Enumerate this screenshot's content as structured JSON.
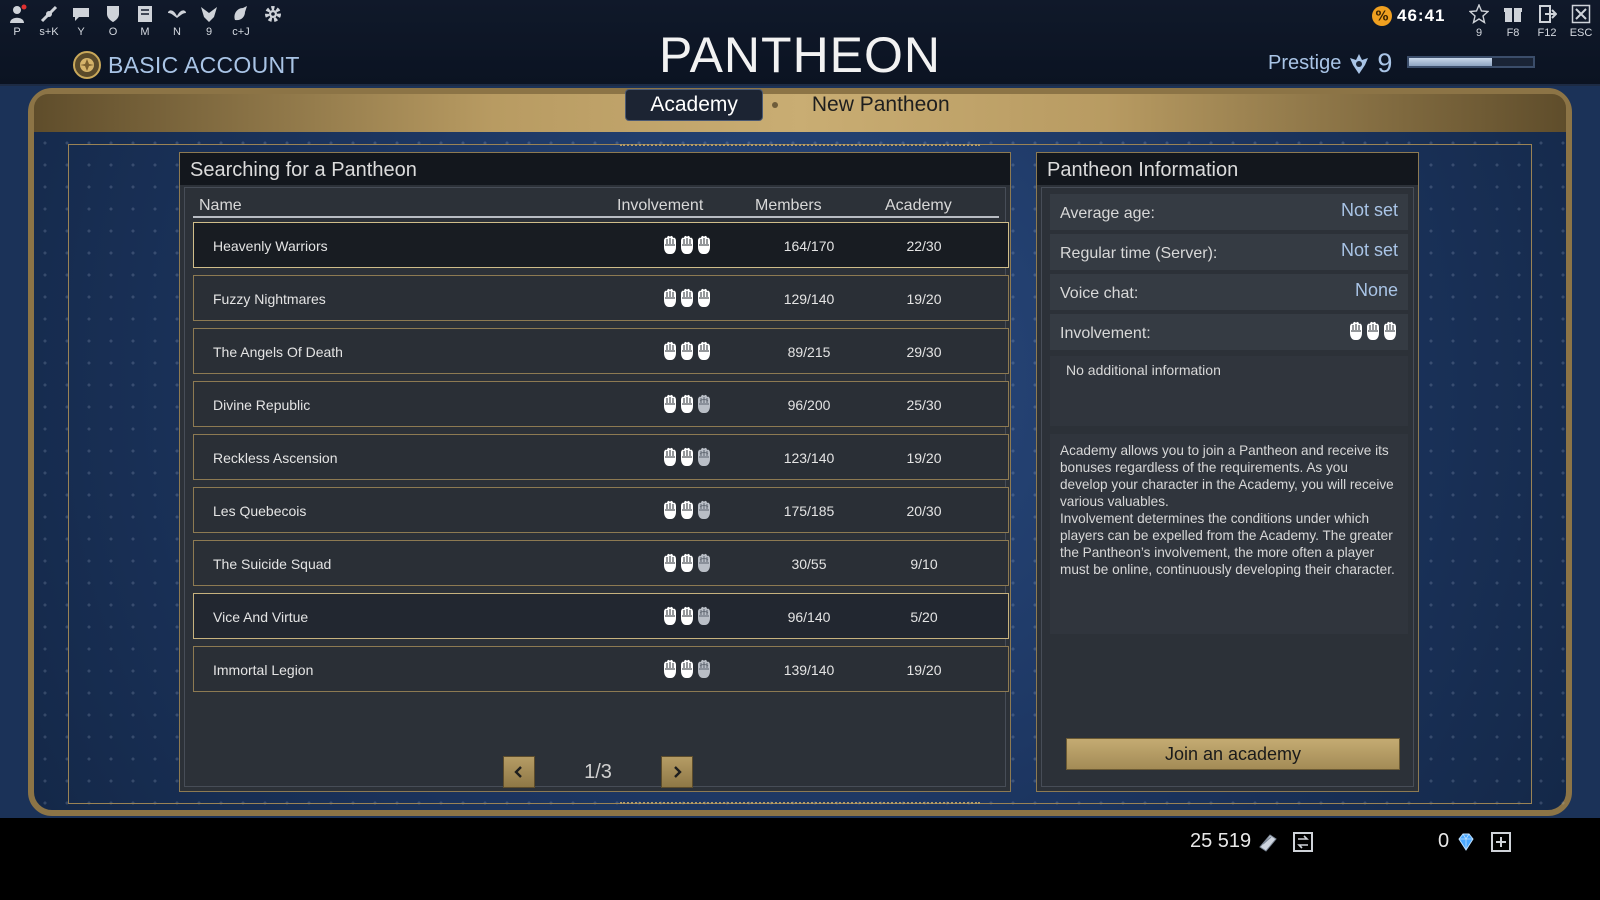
{
  "hotkeys": [
    {
      "label": "P",
      "icon": "character-icon"
    },
    {
      "label": "s+K",
      "icon": "skills-icon"
    },
    {
      "label": "Y",
      "icon": "chat-icon"
    },
    {
      "label": "O",
      "icon": "armor-icon"
    },
    {
      "label": "M",
      "icon": "map-icon"
    },
    {
      "label": "N",
      "icon": "wings-icon"
    },
    {
      "label": "9",
      "icon": "guild-icon"
    },
    {
      "label": "c+J",
      "icon": "hand-icon"
    },
    {
      "label": "",
      "icon": "settings-gear-icon"
    }
  ],
  "account": {
    "label": "BASIC ACCOUNT"
  },
  "title": "PANTHEON",
  "timer": {
    "value": "46:41"
  },
  "top_right": [
    {
      "label": "9",
      "icon": "star-icon"
    },
    {
      "label": "F8",
      "icon": "gift-icon"
    },
    {
      "label": "F12",
      "icon": "exit-door-icon"
    },
    {
      "label": "ESC",
      "icon": "close-icon"
    }
  ],
  "prestige": {
    "label": "Prestige",
    "value": "9",
    "progress": 0.67
  },
  "tabs": [
    {
      "label": "Academy",
      "active": true
    },
    {
      "label": "New Pantheon",
      "active": false
    }
  ],
  "search": {
    "title": "Searching for a Pantheon",
    "columns": {
      "name": "Name",
      "involvement": "Involvement",
      "members": "Members",
      "academy": "Academy"
    },
    "rows": [
      {
        "name": "Heavenly Warriors",
        "involvement": 3,
        "members": "164/170",
        "academy": "22/30",
        "state": "selected"
      },
      {
        "name": "Fuzzy Nightmares",
        "involvement": 3,
        "members": "129/140",
        "academy": "19/20",
        "state": ""
      },
      {
        "name": "The Angels Of Death",
        "involvement": 3,
        "members": "89/215",
        "academy": "29/30",
        "state": ""
      },
      {
        "name": "Divine Republic",
        "involvement": 2,
        "members": "96/200",
        "academy": "25/30",
        "state": ""
      },
      {
        "name": "Reckless Ascension",
        "involvement": 2,
        "members": "123/140",
        "academy": "19/20",
        "state": ""
      },
      {
        "name": "Les Quebecois",
        "involvement": 2,
        "members": "175/185",
        "academy": "20/30",
        "state": ""
      },
      {
        "name": "The Suicide Squad",
        "involvement": 2,
        "members": "30/55",
        "academy": "9/10",
        "state": ""
      },
      {
        "name": "Vice And Virtue",
        "involvement": 2,
        "members": "96/140",
        "academy": "5/20",
        "state": "highlight"
      },
      {
        "name": "Immortal Legion",
        "involvement": 2,
        "members": "139/140",
        "academy": "19/20",
        "state": ""
      }
    ],
    "pager": {
      "label": "1/3"
    }
  },
  "info": {
    "title": "Pantheon Information",
    "average_age": {
      "label": "Average age:",
      "value": "Not set"
    },
    "regular_time": {
      "label": "Regular time (Server):",
      "value": "Not set"
    },
    "voice_chat": {
      "label": "Voice chat:",
      "value": "None"
    },
    "involvement": {
      "label": "Involvement:",
      "level": 3
    },
    "additional": "No additional information",
    "description": "Academy allows you to join a Pantheon and receive its bonuses regardless of the requirements. As you develop your character in the Academy, you will receive various valuables.\nInvolvement determines the conditions under which players can be expelled from the Academy. The greater the Pantheon’s involvement, the more often a player must be online, continuously developing their character.",
    "join_label": "Join an academy"
  },
  "currency": {
    "gold": "25 519",
    "gems": "0"
  },
  "colors": {
    "accent": "#a9c4e6",
    "gold": "#b89b62",
    "timer_badge": "#f0a020",
    "gem": "#4aa8ff"
  }
}
